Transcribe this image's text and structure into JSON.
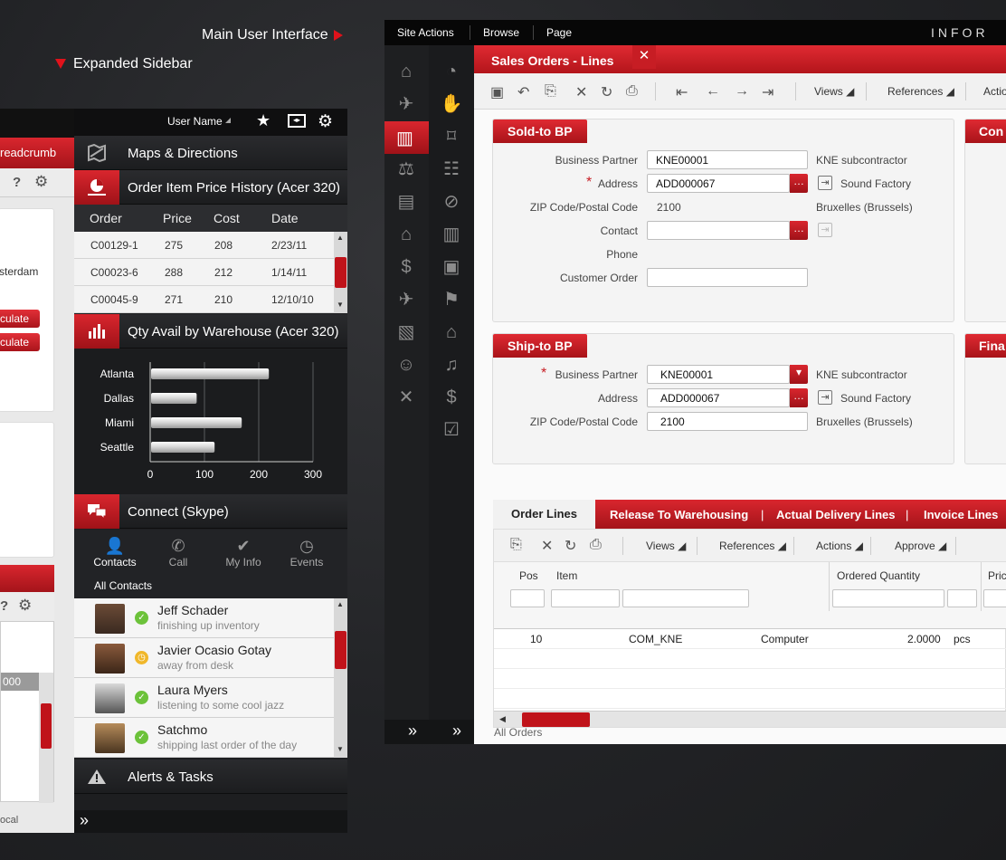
{
  "annotations": {
    "main": "Main User Interface",
    "sidebar": "Expanded Sidebar"
  },
  "back": {
    "breadcrumb": "readcrumb",
    "city": "sterdam",
    "calc1": "culate",
    "calc2": "culate",
    "value": "000",
    "footer": "ocal"
  },
  "sidebar": {
    "user_name": "User Name",
    "maps": "Maps & Directions",
    "order_history": {
      "title": "Order Item Price History (Acer 320)",
      "columns": [
        "Order",
        "Price",
        "Cost",
        "Date"
      ],
      "rows": [
        [
          "C00129-1",
          "275",
          "208",
          "2/23/11"
        ],
        [
          "C00023-6",
          "288",
          "212",
          "1/14/11"
        ],
        [
          "C00045-9",
          "271",
          "210",
          "12/10/10"
        ]
      ]
    },
    "qty_title": "Qty Avail by Warehouse (Acer 320)",
    "connect_title": "Connect (Skype)",
    "connect_tabs": [
      "Contacts",
      "Call",
      "My Info",
      "Events"
    ],
    "all_contacts": "All Contacts",
    "contacts": [
      {
        "name": "Jeff Schader",
        "status": "finishing up inventory",
        "state": "online"
      },
      {
        "name": "Javier Ocasio Gotay",
        "status": "away from desk",
        "state": "away"
      },
      {
        "name": "Laura Myers",
        "status": "listening to some cool jazz",
        "state": "online"
      },
      {
        "name": "Satchmo",
        "status": "shipping last order of the day",
        "state": "online"
      }
    ],
    "alerts": "Alerts & Tasks"
  },
  "chart_data": {
    "type": "bar",
    "orientation": "horizontal",
    "categories": [
      "Atlanta",
      "Dallas",
      "Miami",
      "Seattle"
    ],
    "values": [
      217,
      84,
      167,
      117
    ],
    "xlim": [
      0,
      300
    ],
    "xticks": [
      "0",
      "100",
      "200",
      "300"
    ],
    "title": "",
    "xlabel": "",
    "ylabel": ""
  },
  "main": {
    "menu": [
      "Site Actions",
      "Browse",
      "Page"
    ],
    "logo": "INFOR",
    "title": "Sales Orders - Lines",
    "toolbar": {
      "views": "Views",
      "references": "References",
      "actions": "Actio"
    },
    "sold_to": {
      "title": "Sold-to BP",
      "labels": [
        "Business Partner",
        "Address",
        "ZIP Code/Postal Code",
        "Contact",
        "Phone",
        "Customer Order"
      ],
      "bp": "KNE00001",
      "bp_desc": "KNE subcontractor",
      "address": "ADD000067",
      "address_desc": "Sound Factory",
      "zip": "2100",
      "zip_desc": "Bruxelles (Brussels)",
      "contact": "",
      "customer_order": ""
    },
    "ship_to": {
      "title": "Ship-to BP",
      "labels": [
        "Business Partner",
        "Address",
        "ZIP Code/Postal Code"
      ],
      "bp": "KNE00001",
      "bp_desc": "KNE subcontractor",
      "address": "ADD000067",
      "address_desc": "Sound Factory",
      "zip": "2100",
      "zip_desc": "Bruxelles (Brussels)"
    },
    "right_tags": [
      "Con",
      "Fina"
    ],
    "tabs": [
      "Order Lines",
      "Release To Warehousing",
      "Actual Delivery Lines",
      "Invoice Lines"
    ],
    "grid_toolbar": {
      "views": "Views",
      "references": "References",
      "actions": "Actions",
      "approve": "Approve"
    },
    "grid": {
      "columns": [
        "Pos",
        "Item",
        "Ordered Quantity",
        "Pric"
      ],
      "row": {
        "pos": "10",
        "item": "COM_KNE",
        "desc": "Computer",
        "qty": "2.0000",
        "unit": "pcs"
      }
    },
    "footer": "All Orders"
  }
}
